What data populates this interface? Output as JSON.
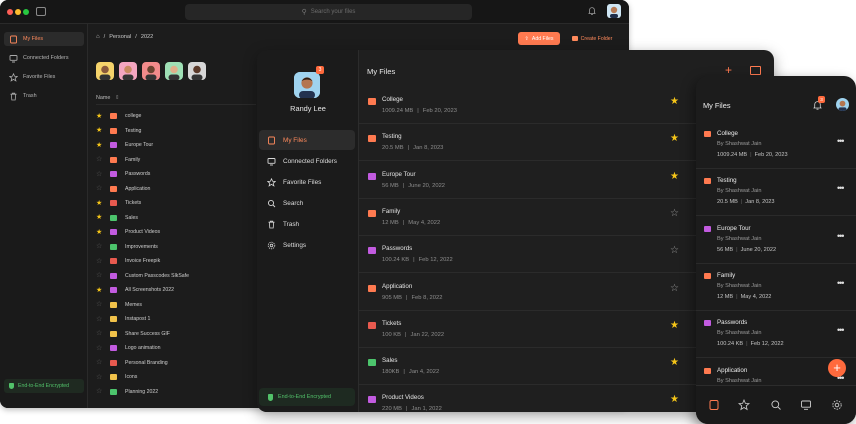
{
  "colors": {
    "accent": "#ff7a50",
    "star": "#f5c518",
    "encrypted": "#52c26a"
  },
  "desktop": {
    "search_placeholder": "Search your files",
    "sidebar": [
      {
        "label": "My Files",
        "icon": "file-icon",
        "active": true
      },
      {
        "label": "Connected Folders",
        "icon": "monitor-icon",
        "active": false
      },
      {
        "label": "Favorite Files",
        "icon": "star-icon",
        "active": false
      },
      {
        "label": "Trash",
        "icon": "trash-icon",
        "active": false
      }
    ],
    "encrypted_label": "End-to-End Encrypted",
    "breadcrumb": {
      "root": "Personal",
      "current": "2022"
    },
    "add_files_label": "Add Files",
    "create_folder_label": "Create Folder",
    "column_name": "Name",
    "rows": [
      {
        "name": "college",
        "type": "folder",
        "starred": true
      },
      {
        "name": "Testing",
        "type": "folder",
        "starred": true
      },
      {
        "name": "Europe Tour",
        "type": "video",
        "starred": true
      },
      {
        "name": "Family",
        "type": "folder",
        "starred": false
      },
      {
        "name": "Passwords",
        "type": "doc",
        "starred": false
      },
      {
        "name": "Application",
        "type": "folder",
        "starred": false
      },
      {
        "name": "Tickets",
        "type": "pdf",
        "starred": true
      },
      {
        "name": "Sales",
        "type": "sheet",
        "starred": true
      },
      {
        "name": "Product Videos",
        "type": "video",
        "starred": true
      },
      {
        "name": "Improvements",
        "type": "sheet",
        "starred": false
      },
      {
        "name": "Invoice Freepik",
        "type": "pdf",
        "starred": false
      },
      {
        "name": "Custom Passcodes SlkSafe",
        "type": "doc",
        "starred": false
      },
      {
        "name": "All Screenshots 2022",
        "type": "doc",
        "starred": true
      },
      {
        "name": "Memes",
        "type": "image",
        "starred": false
      },
      {
        "name": "Instapost 1",
        "type": "image",
        "starred": false
      },
      {
        "name": "Share Success GIF",
        "type": "image",
        "starred": false
      },
      {
        "name": "Logo animation",
        "type": "video",
        "starred": false
      },
      {
        "name": "Personal Branding",
        "type": "pdf",
        "starred": false
      },
      {
        "name": "Icons",
        "type": "image",
        "starred": false
      },
      {
        "name": "Planning 2022",
        "type": "sheet",
        "starred": false
      }
    ]
  },
  "tablet": {
    "user_name": "Randy Lee",
    "notification_count": "3",
    "title": "My Files",
    "sidebar": [
      {
        "label": "My Files",
        "icon": "file-icon",
        "active": true
      },
      {
        "label": "Connected Folders",
        "icon": "monitor-icon",
        "active": false
      },
      {
        "label": "Favorite Files",
        "icon": "star-icon",
        "active": false
      },
      {
        "label": "Search",
        "icon": "search-icon",
        "active": false
      },
      {
        "label": "Trash",
        "icon": "trash-icon",
        "active": false
      },
      {
        "label": "Settings",
        "icon": "gear-icon",
        "active": false
      }
    ],
    "encrypted_label": "End-to-End Encrypted",
    "files": [
      {
        "name": "College",
        "size": "1009.24 MB",
        "date": "Feb 20, 2023",
        "type": "folder",
        "starred": true
      },
      {
        "name": "Testing",
        "size": "20.5 MB",
        "date": "Jan 8, 2023",
        "type": "folder",
        "starred": true
      },
      {
        "name": "Europe Tour",
        "size": "56 MB",
        "date": "June 20, 2022",
        "type": "video",
        "starred": true
      },
      {
        "name": "Family",
        "size": "12 MB",
        "date": "May 4, 2022",
        "type": "folder",
        "starred": false
      },
      {
        "name": "Passwords",
        "size": "100.24 KB",
        "date": "Feb 12, 2022",
        "type": "doc",
        "starred": false
      },
      {
        "name": "Application",
        "size": "905 MB",
        "date": "Feb 8, 2022",
        "type": "folder",
        "starred": false
      },
      {
        "name": "Tickets",
        "size": "100 KB",
        "date": "Jan 22, 2022",
        "type": "pdf",
        "starred": true
      },
      {
        "name": "Sales",
        "size": "180KB",
        "date": "Jan 4, 2022",
        "type": "sheet",
        "starred": true
      },
      {
        "name": "Product Videos",
        "size": "220 MB",
        "date": "Jan 1, 2022",
        "type": "video",
        "starred": true
      }
    ]
  },
  "phone": {
    "title": "My Files",
    "notification_count": "3",
    "files": [
      {
        "name": "College",
        "by": "By Shashwat Jain",
        "size": "1009.24 MB",
        "date": "Feb 20, 2023",
        "type": "folder"
      },
      {
        "name": "Testing",
        "by": "By Shashwat Jain",
        "size": "20.5 MB",
        "date": "Jan 8, 2023",
        "type": "folder"
      },
      {
        "name": "Europe Tour",
        "by": "By Shashwat Jain",
        "size": "56 MB",
        "date": "June 20, 2022",
        "type": "video"
      },
      {
        "name": "Family",
        "by": "By Shashwat Jain",
        "size": "12 MB",
        "date": "May 4, 2022",
        "type": "folder"
      },
      {
        "name": "Passwords",
        "by": "By Shashwat Jain",
        "size": "100.24 KB",
        "date": "Feb 12, 2022",
        "type": "doc"
      },
      {
        "name": "Application",
        "by": "By Shashwat Jain",
        "size": "",
        "date": "",
        "type": "folder"
      }
    ],
    "bottom_nav": [
      "file-icon",
      "star-icon",
      "search-icon",
      "monitor-icon",
      "gear-icon"
    ]
  }
}
